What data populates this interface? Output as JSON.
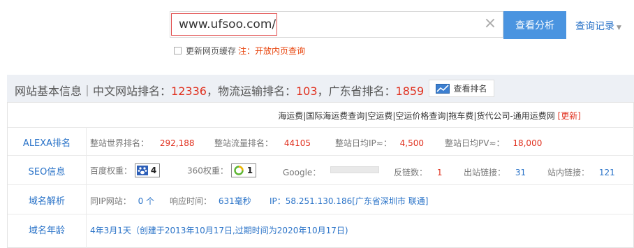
{
  "search": {
    "value": "www.ufsoo.com/",
    "analyze_label": "查看分析",
    "history_label": "查询记录",
    "cache_label": "更新网页缓存",
    "cache_note": "注：开放内页查询"
  },
  "header": {
    "title": "网站基本信息",
    "sep": "｜中文网站排名：",
    "cn_rank": "12336",
    "logistics_label": "，物流运输排名：",
    "logistics_rank": "103",
    "province_label": "，广东省排名：",
    "province_rank": "1859",
    "rank_button": "查看排名"
  },
  "links": {
    "text": "海运费|国际海运费查询|空运费|空运价格查询|拖车费|货代公司-通用运费网",
    "more": "[更新]"
  },
  "rows": {
    "alexa": {
      "label": "ALEXA排名",
      "world_rank_label": "整站世界排名：",
      "world_rank": "292,188",
      "traffic_rank_label": "整站流量排名：",
      "traffic_rank": "44105",
      "daily_ip_label": "整站日均IP≈：",
      "daily_ip": "4,500",
      "daily_pv_label": "整站日均PV≈：",
      "daily_pv": "18,000"
    },
    "seo": {
      "label": "SEO信息",
      "baidu_label": "百度权重：",
      "baidu_weight": "4",
      "s360_label": "360权重：",
      "s360_weight": "1",
      "google_label": "Google：",
      "backlinks_label": "反链数：",
      "backlinks": "1",
      "outbound_label": "出站链接：",
      "outbound": "31",
      "internal_label": "站内链接：",
      "internal": "121"
    },
    "dns": {
      "label": "域名解析",
      "same_ip_label": "同IP网站：",
      "same_ip": "0 个",
      "response_label": "响应时间：",
      "response": "631毫秒",
      "ip_label": "IP：",
      "ip": "58.251.130.186[广东省深圳市 联通]"
    },
    "age": {
      "label": "域名年龄",
      "value": "4年3月1天（创建于2013年10月17日,过期时间为2020年10月17日)"
    }
  },
  "colors": {
    "accent": "#4a94e0",
    "red": "#e0301e",
    "link": "#2a73c8"
  }
}
